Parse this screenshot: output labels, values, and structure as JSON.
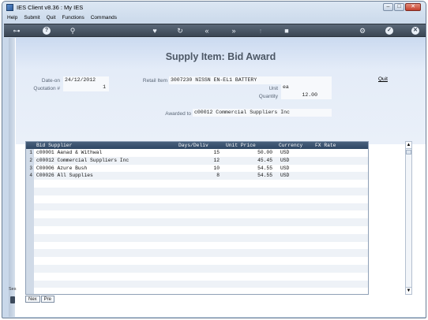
{
  "window": {
    "title": "IES Client v8.36 : My IES"
  },
  "menu": [
    "Help",
    "Submit",
    "Quit",
    "Functions",
    "Commands"
  ],
  "toolbar_icons": [
    "key-icon",
    "help-icon",
    "search-icon",
    "heart-icon",
    "refresh-icon",
    "rewind-icon",
    "forward-icon",
    "up-icon",
    "stop-icon",
    "settings-icon",
    "check-icon",
    "close-icon"
  ],
  "page": {
    "title": "Supply Item: Bid Award",
    "quit_label": "Quit"
  },
  "form": {
    "date_on_label": "Date-on",
    "date_on": "24/12/2012",
    "quotation_label": "Quotation #",
    "quotation": "1",
    "retail_item_label": "Retail Item",
    "retail_item": "3007230 NISSN EN-EL1 BATTERY",
    "unit_label": "Unit",
    "unit": "ea",
    "quantity_label": "Quantity",
    "quantity": "12.00",
    "awarded_to_label": "Awarded to",
    "awarded_to": "c00012 Commercial Suppliers Inc"
  },
  "grid": {
    "columns": [
      "Bid Supplier",
      "Days/Deliv",
      "Unit Price",
      "Currency",
      "FX Rate"
    ],
    "rows": [
      {
        "n": "1",
        "supplier": "c00001 Aanad & Withwal",
        "days": "15",
        "price": "50.00",
        "currency": "USD",
        "fx": ""
      },
      {
        "n": "2",
        "supplier": "c00012 Commercial Suppliers Inc",
        "days": "12",
        "price": "45.45",
        "currency": "USD",
        "fx": ""
      },
      {
        "n": "3",
        "supplier": "C00006 Azure Bush",
        "days": "10",
        "price": "54.55",
        "currency": "USD",
        "fx": ""
      },
      {
        "n": "4",
        "supplier": "C00026 All Supplies",
        "days": "8",
        "price": "54.55",
        "currency": "USD",
        "fx": ""
      }
    ]
  },
  "bottom": {
    "tab_next": "Nex",
    "tab_prev": "Pre",
    "ses_label": "Ses"
  }
}
